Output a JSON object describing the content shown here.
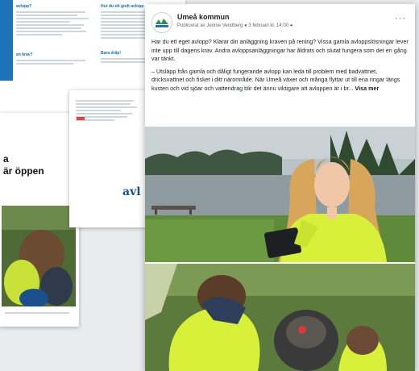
{
  "brochure": {
    "heading_left": "avlopp?",
    "heading_right": "Hur du ett godt avlopp",
    "heading_bottom_left": "en krav?",
    "heading_bottom_right": "Bara dråp!"
  },
  "poster": {
    "title_line1": "a",
    "title_line2": "är öppen"
  },
  "midpage": {
    "logo_text": "avl"
  },
  "post": {
    "page_name": "Umeå kommun",
    "meta": "Publicerat av Jennie Vendberg ● 3 februari kl. 14:00 ●",
    "more_label": "···",
    "paragraph1": "Har du ett eget avlopp? Klarar din anläggning kraven på rening? Vissa gamla avloppslösningar lever inte upp till dagens krav. Andra avloppsanläggningar har åldrats och slutat fungera som det en gång var tänkt.",
    "paragraph2": "– Utsläpp från gamla och dåligt fungerande avlopp kan leda till problem med badvattnet, dricksvattnet och fisket i ditt närområde. När Umeå växer och många flyttar ut till ena ringar längs kusten och vid sjöar och vattendrag blir det ännu viktigare att avloppen är i br...",
    "see_more": "Visa mer"
  },
  "colors": {
    "facebook_text": "#1c1e21",
    "muted": "#65676b",
    "safety_yellow": "#d8f03a"
  }
}
